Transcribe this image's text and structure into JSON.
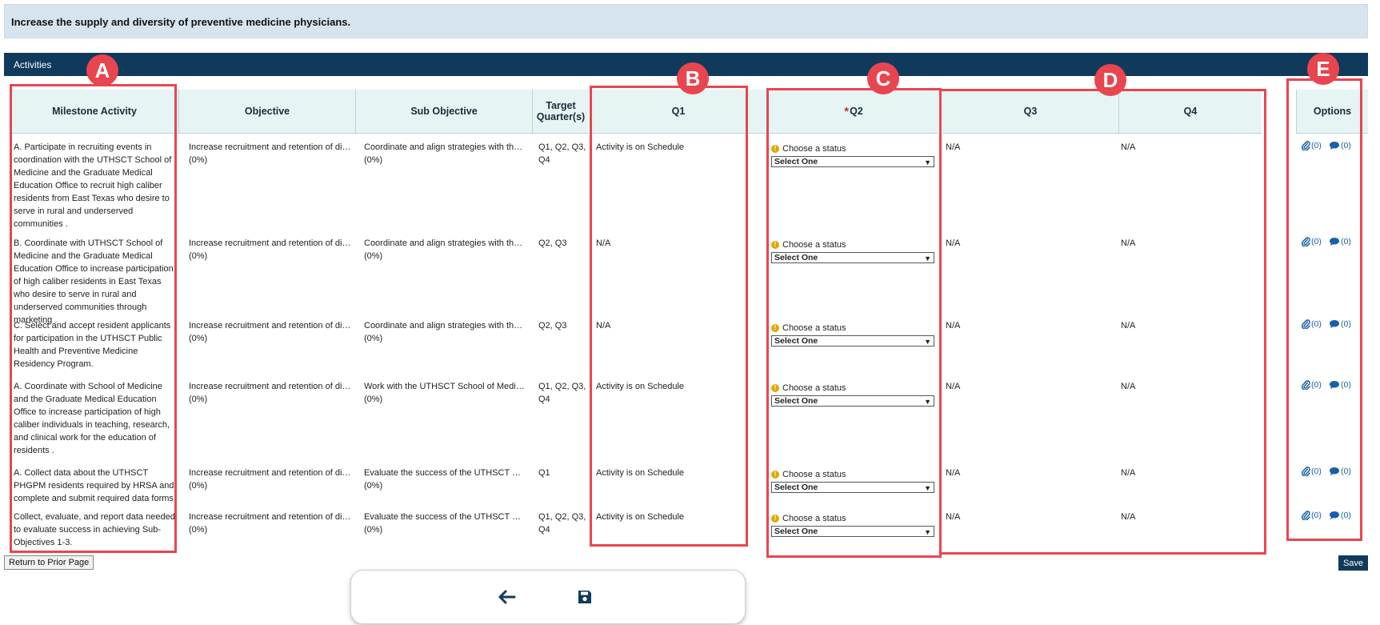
{
  "goal_title": "Increase the supply and diversity of preventive medicine physicians.",
  "section_title": "Activities",
  "columns": {
    "milestone": "Milestone Activity",
    "objective": "Objective",
    "sub_objective": "Sub Objective",
    "target": "Target Quarter(s)",
    "q1": "Q1",
    "q2_required": "*",
    "q2": "Q2",
    "q3": "Q3",
    "q4": "Q4",
    "options": "Options"
  },
  "rows": [
    {
      "milestone": "A. Participate in recruiting events in coordination with the UTHSCT School of Medicine and the Graduate Medical Education Office to recruit high caliber residents from East Texas who desire to serve in rural and underserved communities .",
      "objective": "Increase recruitment and retention of diverse physicians in East Texas",
      "objective_pct": "(0%)",
      "sub_objective": "Coordinate and align strategies with the UTHSCT School of Medicine",
      "sub_objective_pct": "(0%)",
      "target": "Q1, Q2, Q3, Q4",
      "q1": "Activity is on Schedule",
      "q2_label": "Choose a status",
      "q2_select": "Select One",
      "q3": "N/A",
      "q4": "N/A",
      "attachments": "(0)",
      "comments": "(0)"
    },
    {
      "milestone": "B. Coordinate with UTHSCT School of Medicine and the Graduate Medical Education Office to increase participation of high caliber residents in East Texas who desire to serve in rural and underserved communities through marketing .",
      "objective": "Increase recruitment and retention of diverse physicians in East Texas",
      "objective_pct": "(0%)",
      "sub_objective": "Coordinate and align strategies with the UTHSCT School of Medicine",
      "sub_objective_pct": "(0%)",
      "target": "Q2, Q3",
      "q1": "N/A",
      "q2_label": "Choose a status",
      "q2_select": "Select One",
      "q3": "N/A",
      "q4": "N/A",
      "attachments": "(0)",
      "comments": "(0)"
    },
    {
      "milestone": "C. Select and accept resident applicants for participation in the UTHSCT Public Health and Preventive Medicine Residency Program.",
      "objective": "Increase recruitment and retention of diverse physicians in East Texas",
      "objective_pct": "(0%)",
      "sub_objective": "Coordinate and align strategies with the UTHSCT School of Medicine",
      "sub_objective_pct": "(0%)",
      "target": "Q2, Q3",
      "q1": "N/A",
      "q2_label": "Choose a status",
      "q2_select": "Select One",
      "q3": "N/A",
      "q4": "N/A",
      "attachments": "(0)",
      "comments": "(0)"
    },
    {
      "milestone": "A. Coordinate with School of Medicine and the Graduate Medical Education Office to increase participation of high caliber individuals in teaching, research, and clinical work for the education of residents .",
      "objective": "Increase recruitment and retention of diverse physicians in East Texas",
      "objective_pct": "(0%)",
      "sub_objective": "Work with the UTHSCT School of Medicine",
      "sub_objective_pct": "(0%)",
      "target": "Q1, Q2, Q3, Q4",
      "q1": "Activity is on Schedule",
      "q2_label": "Choose a status",
      "q2_select": "Select One",
      "q3": "N/A",
      "q4": "N/A",
      "attachments": "(0)",
      "comments": "(0)"
    },
    {
      "milestone": "A. Collect data about the UTHSCT PHGPM residents required by HRSA and complete and submit required data forms.",
      "objective": "Increase recruitment and retention of diverse physicians in East Texas",
      "objective_pct": "(0%)",
      "sub_objective": "Evaluate the success of the UTHSCT PHGPM residency",
      "sub_objective_pct": "(0%)",
      "target": "Q1",
      "q1": "Activity is on Schedule",
      "q2_label": "Choose a status",
      "q2_select": "Select One",
      "q3": "N/A",
      "q4": "N/A",
      "attachments": "(0)",
      "comments": "(0)"
    },
    {
      "milestone": "Collect, evaluate, and report data needed to evaluate success in achieving Sub-Objectives 1-3.",
      "objective": "Increase recruitment and retention of diverse physicians in East Texas",
      "objective_pct": "(0%)",
      "sub_objective": "Evaluate the success of the UTHSCT PHGPM residency",
      "sub_objective_pct": "(0%)",
      "target": "Q1, Q2, Q3, Q4",
      "q1": "Activity is on Schedule",
      "q2_label": "Choose a status",
      "q2_select": "Select One",
      "q3": "N/A",
      "q4": "N/A",
      "attachments": "(0)",
      "comments": "(0)"
    }
  ],
  "callouts": {
    "a": "A",
    "b": "B",
    "c": "C",
    "d": "D",
    "e": "E"
  },
  "buttons": {
    "return_prior": "Return to Prior Page",
    "save": "Save"
  },
  "bottom_toolbar": {
    "back_icon": "arrow-left-icon",
    "save_icon": "floppy-disk-icon"
  },
  "colors": {
    "banner": "#d6e4f0",
    "section_bar": "#0f3a5c",
    "header_bg": "#e6f4f3",
    "callout": "#e8454f",
    "link": "#1a5fa8",
    "warning": "#e0a800"
  }
}
